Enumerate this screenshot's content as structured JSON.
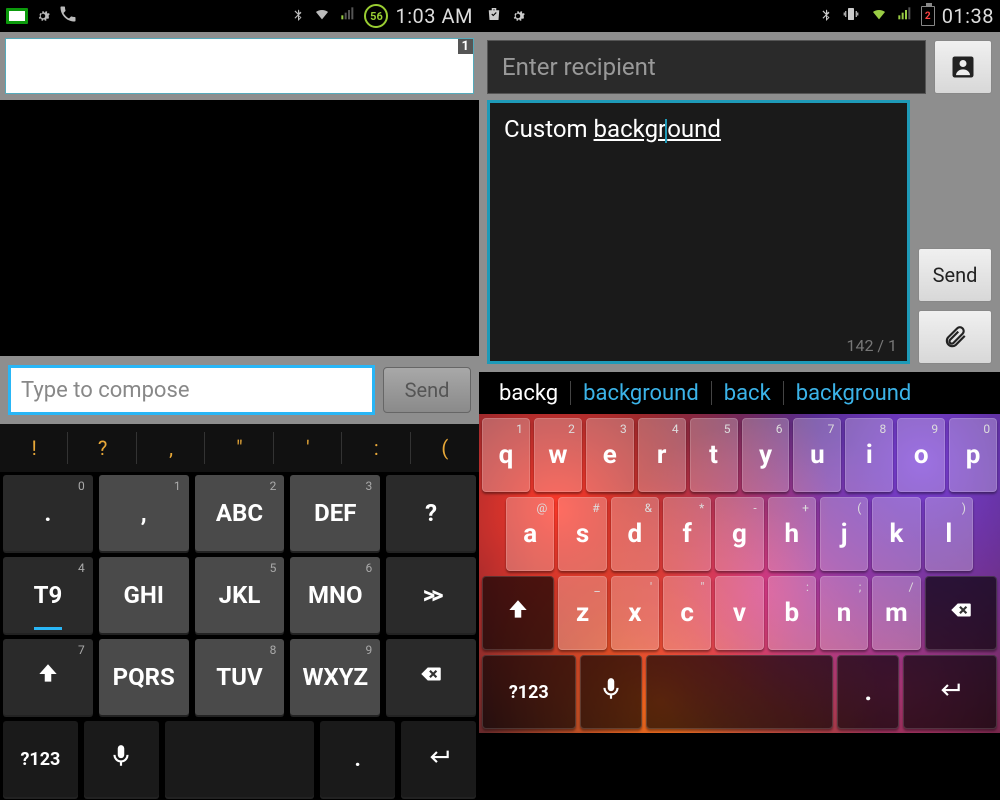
{
  "left": {
    "status": {
      "battery": "56",
      "clock": "1:03 AM"
    },
    "recipient_count": "1",
    "compose_placeholder": "Type to compose",
    "send_label": "Send",
    "punct_row": [
      "!",
      "?",
      ",",
      "\"",
      "'",
      ":",
      "("
    ],
    "t9": {
      "rows": [
        [
          {
            "main": ".",
            "sup": "0"
          },
          {
            "main": ",",
            "sup": "1"
          },
          {
            "main": "ABC",
            "sup": "2"
          },
          {
            "main": "DEF",
            "sup": "3"
          },
          {
            "main": "?",
            "sup": ""
          }
        ],
        [
          {
            "main": "T9",
            "sup": "4"
          },
          {
            "main": "GHI",
            "sup": ""
          },
          {
            "main": "JKL",
            "sup": "5"
          },
          {
            "main": "MNO",
            "sup": "6"
          },
          {
            "main": ">>",
            "sup": ""
          }
        ],
        [
          {
            "main": "shift",
            "sup": "7"
          },
          {
            "main": "PQRS",
            "sup": ""
          },
          {
            "main": "TUV",
            "sup": "8"
          },
          {
            "main": "WXYZ",
            "sup": "9"
          },
          {
            "main": "bksp",
            "sup": ""
          }
        ],
        [
          {
            "main": "?123",
            "sup": ""
          },
          {
            "main": "mic",
            "sup": ""
          },
          {
            "main": "space",
            "sup": ""
          },
          {
            "main": ". ",
            "sup": ""
          },
          {
            "main": "enter",
            "sup": ""
          }
        ]
      ]
    },
    "sym_label": "?123"
  },
  "right": {
    "status": {
      "battery": "2",
      "clock": "01:38"
    },
    "recipient_placeholder": "Enter recipient",
    "message_text_pre": "Custom ",
    "message_text_underlined": "backgr",
    "message_text_post": "ound",
    "char_count": "142 / 1",
    "send_label": "Send",
    "suggestions": [
      "backg",
      "background",
      "back",
      "background"
    ],
    "qwerty": {
      "row1": [
        {
          "k": "q",
          "s": "1"
        },
        {
          "k": "w",
          "s": "2"
        },
        {
          "k": "e",
          "s": "3"
        },
        {
          "k": "r",
          "s": "4"
        },
        {
          "k": "t",
          "s": "5"
        },
        {
          "k": "y",
          "s": "6"
        },
        {
          "k": "u",
          "s": "7"
        },
        {
          "k": "i",
          "s": "8"
        },
        {
          "k": "o",
          "s": "9"
        },
        {
          "k": "p",
          "s": "0"
        }
      ],
      "row2": [
        {
          "k": "a",
          "s": "@"
        },
        {
          "k": "s",
          "s": "#"
        },
        {
          "k": "d",
          "s": "&"
        },
        {
          "k": "f",
          "s": "*"
        },
        {
          "k": "g",
          "s": "-"
        },
        {
          "k": "h",
          "s": "+"
        },
        {
          "k": "j",
          "s": "("
        },
        {
          "k": "k",
          "s": ""
        },
        {
          "k": "l",
          "s": ")"
        }
      ],
      "row3": [
        {
          "k": "z",
          "s": "_"
        },
        {
          "k": "x",
          "s": "'"
        },
        {
          "k": "c",
          "s": "\""
        },
        {
          "k": "v",
          "s": ""
        },
        {
          "k": "b",
          "s": ":"
        },
        {
          "k": "n",
          "s": ";"
        },
        {
          "k": "m",
          "s": "/"
        }
      ]
    },
    "sym_label": "?123",
    "period_key": "."
  }
}
